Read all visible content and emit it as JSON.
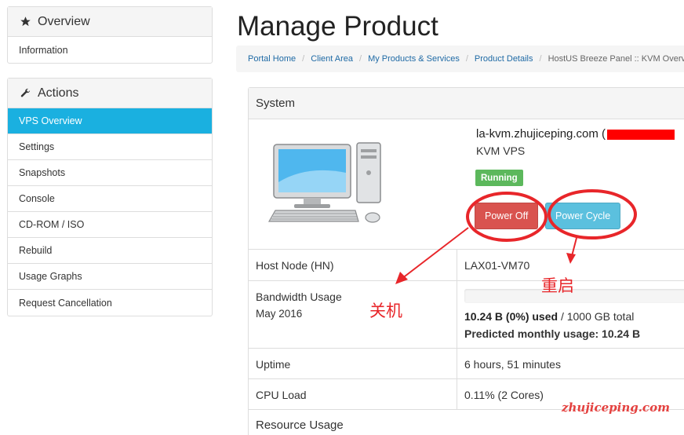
{
  "sidebar": {
    "overview": {
      "title": "Overview",
      "icon": "star-icon",
      "items": [
        {
          "label": "Information"
        }
      ]
    },
    "actions": {
      "title": "Actions",
      "icon": "wrench-icon",
      "items": [
        {
          "label": "VPS Overview",
          "active": true
        },
        {
          "label": "Settings"
        },
        {
          "label": "Snapshots"
        },
        {
          "label": "Console"
        },
        {
          "label": "CD-ROM / ISO"
        },
        {
          "label": "Rebuild"
        },
        {
          "label": "Usage Graphs"
        },
        {
          "label": "Request Cancellation"
        }
      ]
    }
  },
  "main": {
    "title": "Manage Product",
    "breadcrumb": [
      "Portal Home",
      "Client Area",
      "My Products & Services",
      "Product Details"
    ],
    "breadcrumb_current": "HostUS Breeze Panel :: KVM Overview",
    "system": {
      "heading": "System",
      "hostname": "la-kvm.zhujiceping.com (",
      "type": "KVM VPS",
      "status": "Running",
      "power_off_label": "Power Off",
      "power_cycle_label": "Power Cycle"
    },
    "details": {
      "host_node_label": "Host Node (HN)",
      "host_node_value": "LAX01-VM70",
      "bandwidth_label": "Bandwidth Usage",
      "bandwidth_period": "May 2016",
      "bandwidth_used": "10.24 B (0%) used",
      "bandwidth_total": " / 1000 GB total",
      "bandwidth_predicted": "Predicted monthly usage: 10.24 B",
      "bandwidth_percent": 0,
      "uptime_label": "Uptime",
      "uptime_value": "6 hours, 51 minutes",
      "cpu_label": "CPU Load",
      "cpu_value": "0.11% (2 Cores)",
      "resource_label": "Resource Usage"
    }
  },
  "annotations": {
    "power_off_note": "关机",
    "power_cycle_note": "重启",
    "watermark": "zhujiceping.com",
    "color": "#e8262a"
  },
  "colors": {
    "active": "#1ab0e0",
    "running": "#5cb85c",
    "danger": "#d9534f",
    "info": "#5bc0de"
  }
}
